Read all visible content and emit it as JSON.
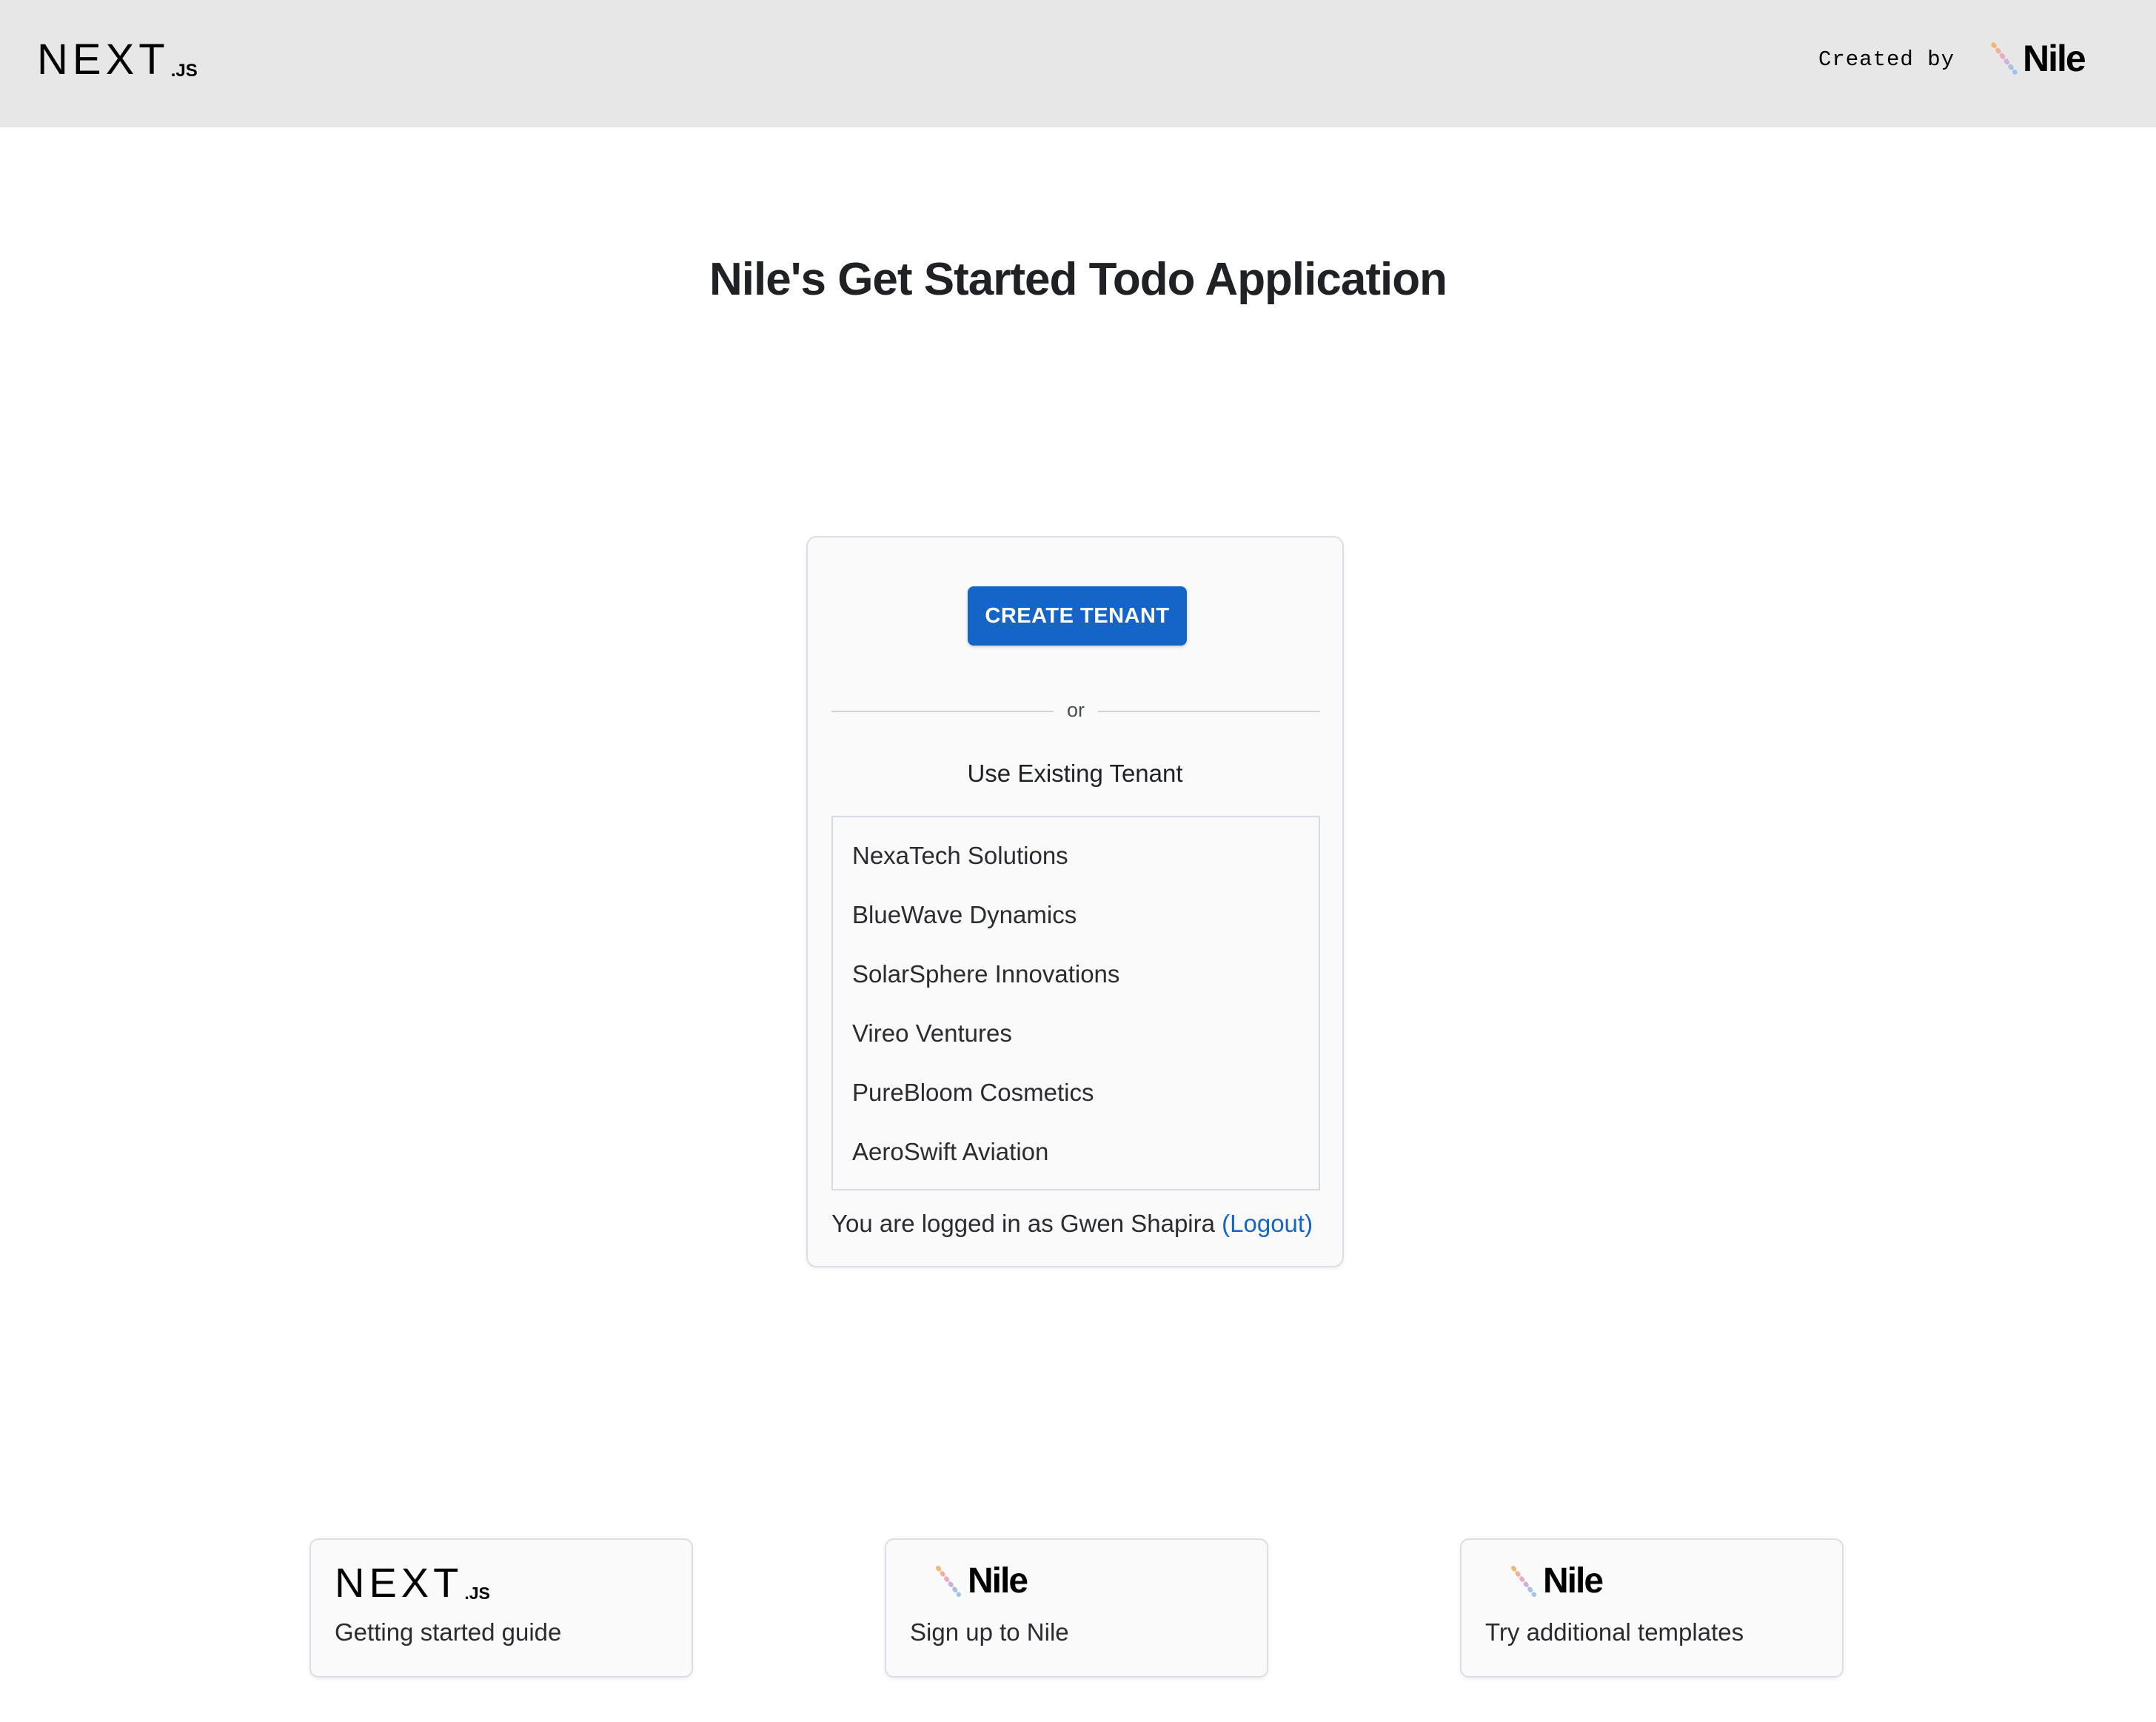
{
  "header": {
    "next_logo": {
      "word": "NEXT",
      "suffix": ".JS"
    },
    "created_by": "Created by",
    "nile_logo": {
      "word": "Nile"
    }
  },
  "page": {
    "title": "Nile's Get Started Todo Application"
  },
  "tenant_card": {
    "create_button": "CREATE TENANT",
    "divider_text": "or",
    "existing_label": "Use Existing Tenant",
    "tenants": [
      "NexaTech Solutions",
      "BlueWave Dynamics",
      "SolarSphere Innovations",
      "Vireo Ventures",
      "PureBloom Cosmetics",
      "AeroSwift Aviation"
    ],
    "login_prefix": "You are logged in as Gwen Shapira",
    "logout_label": "(Logout)"
  },
  "footer_cards": [
    {
      "logo": "next",
      "logo_word": "NEXT",
      "logo_suffix": ".JS",
      "caption": "Getting started guide"
    },
    {
      "logo": "nile",
      "logo_word": "Nile",
      "caption": "Sign up to Nile"
    },
    {
      "logo": "nile",
      "logo_word": "Nile",
      "caption": "Try additional templates"
    }
  ],
  "colors": {
    "header_bg": "#e7e7e7",
    "primary": "#1565c8",
    "card_bg": "#fafafb",
    "border": "#dcdee3"
  },
  "icons": {
    "nile_mark": "nile-n-gradient-icon"
  }
}
